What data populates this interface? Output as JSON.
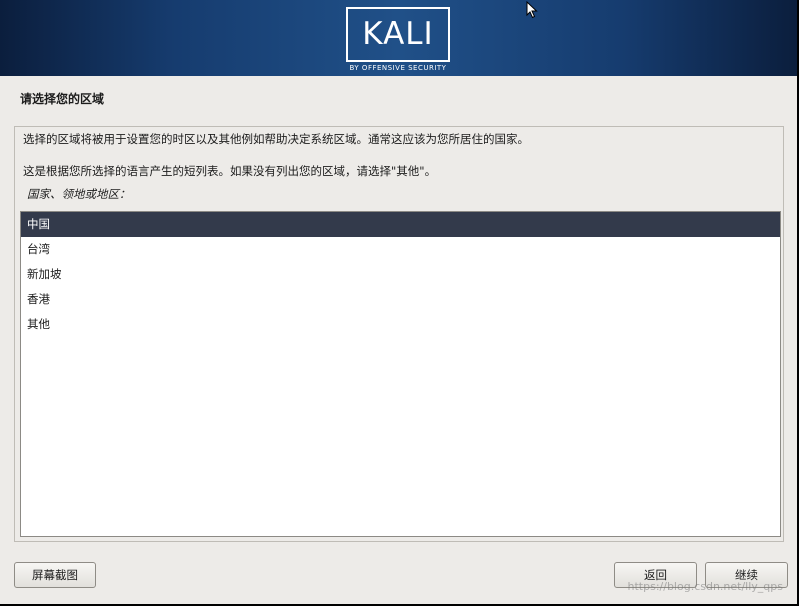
{
  "brand": {
    "logo_text": "KALI",
    "tagline": "BY OFFENSIVE SECURITY"
  },
  "page": {
    "title": "请选择您的区域",
    "description_1": "选择的区域将被用于设置您的时区以及其他例如帮助决定系统区域。通常这应该为您所居住的国家。",
    "description_2": "这是根据您所选择的语言产生的短列表。如果没有列出您的区域，请选择\"其他\"。",
    "list_label": "国家、领地或地区："
  },
  "countries": {
    "selected": "中国",
    "items": [
      "中国",
      "台湾",
      "新加坡",
      "香港",
      "其他"
    ]
  },
  "buttons": {
    "screenshot": "屏幕截图",
    "back": "返回",
    "continue": "继续"
  },
  "watermark": "https://blog.csdn.net/lly_qps",
  "icons": {
    "cursor": "mouse-pointer-icon"
  },
  "colors": {
    "banner": "#1a4780",
    "selection": "#333a4b",
    "background": "#edebe8"
  }
}
